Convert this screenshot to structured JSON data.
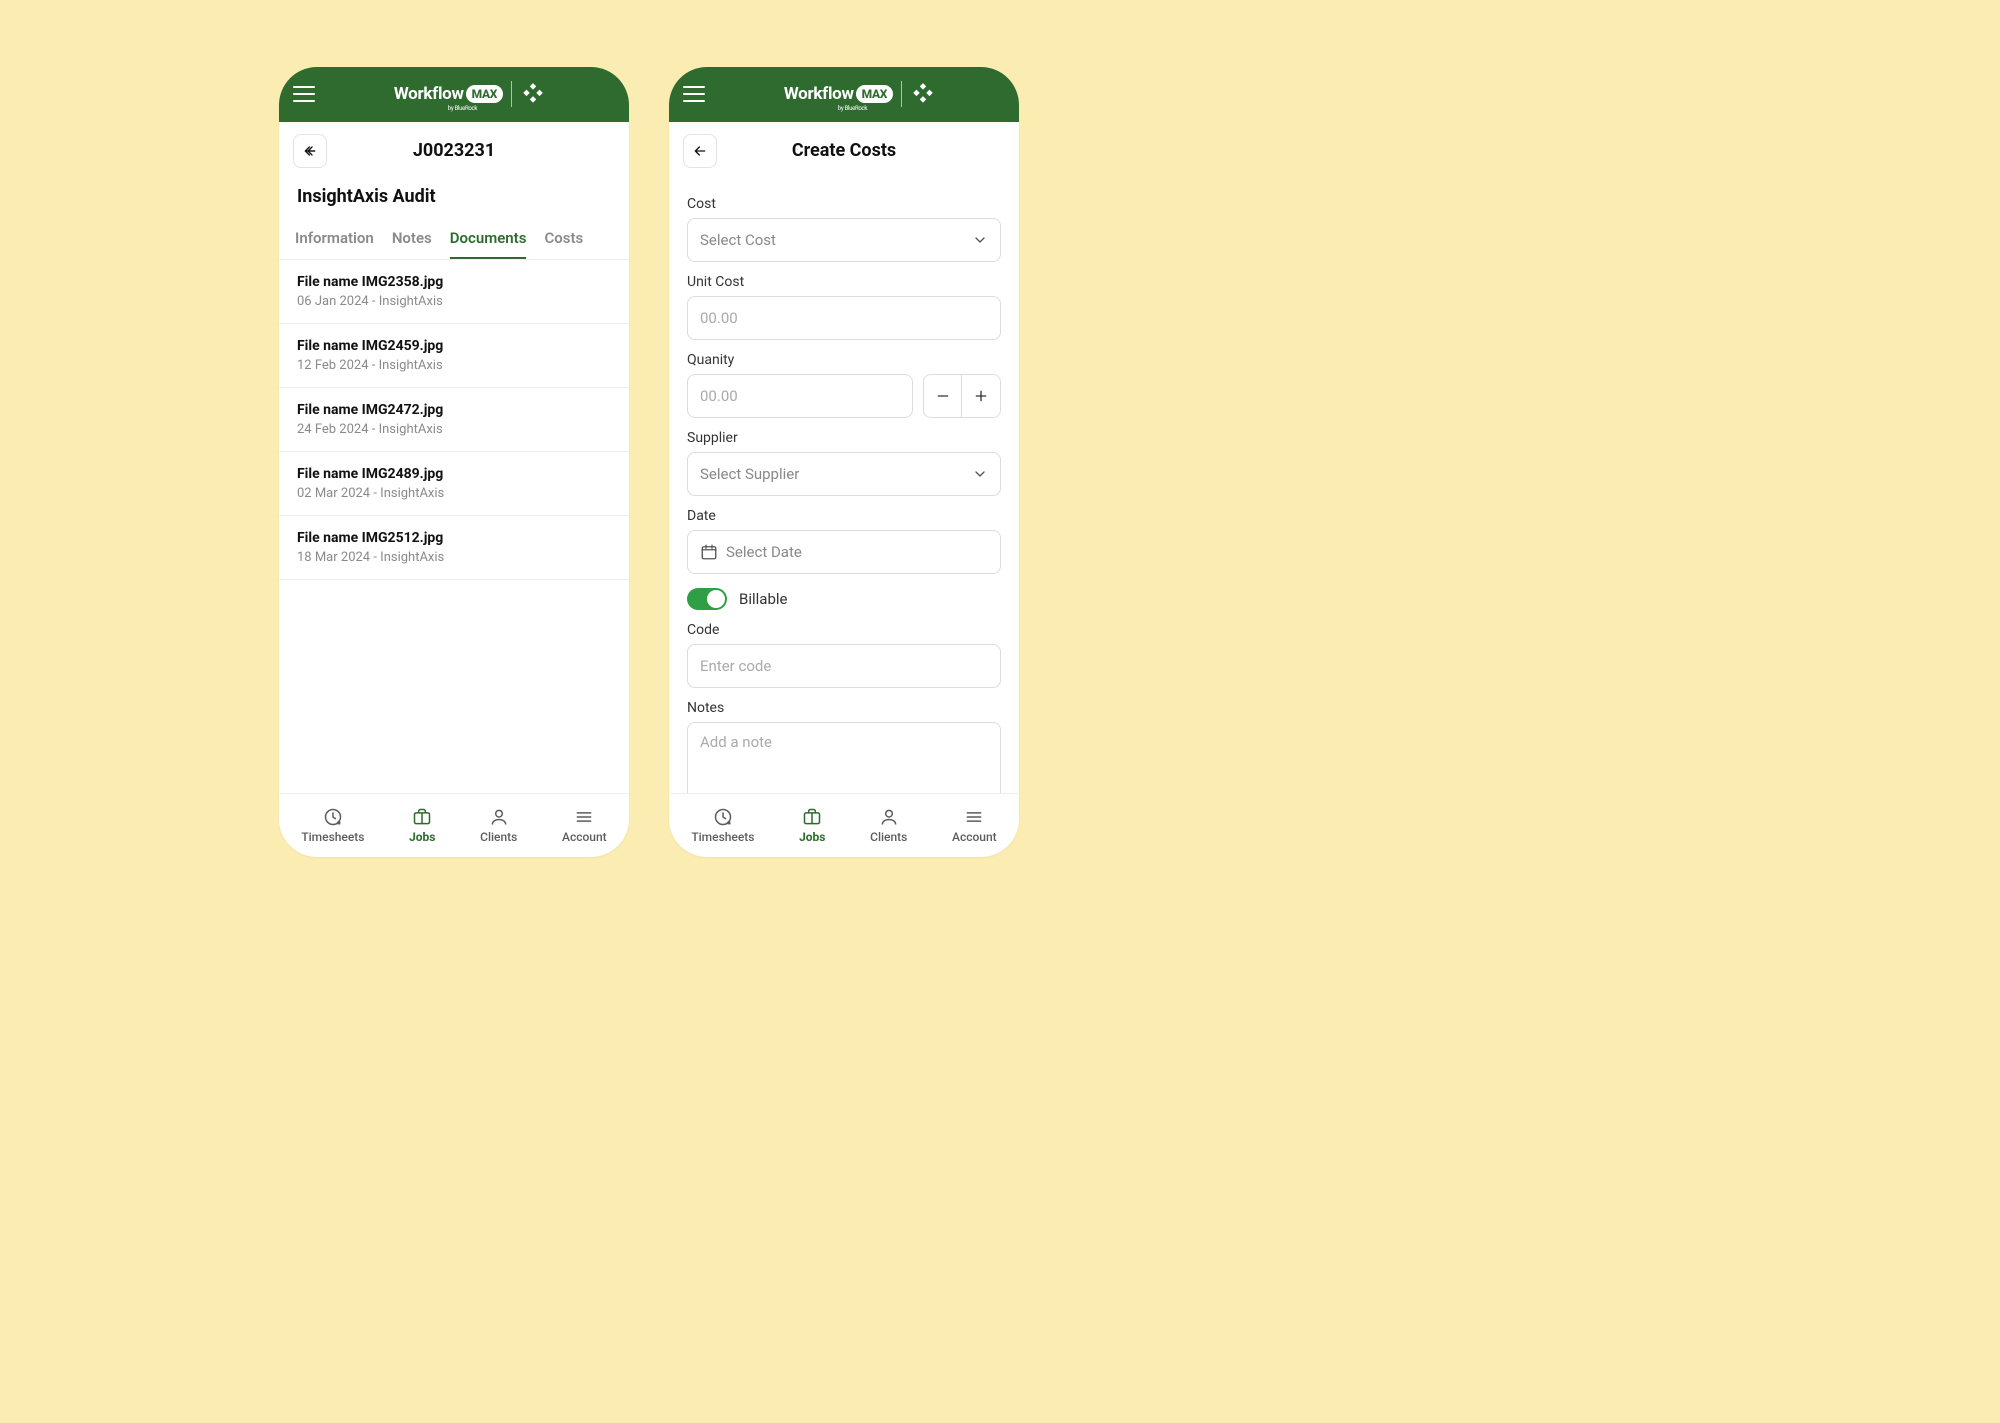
{
  "brand": {
    "word": "Workflow",
    "badge": "MAX",
    "sub": "by BlueRock"
  },
  "left": {
    "header_title": "J0023231",
    "job_title": "InsightAxis Audit",
    "tabs": [
      {
        "label": "Information"
      },
      {
        "label": "Notes"
      },
      {
        "label": "Documents"
      },
      {
        "label": "Costs"
      }
    ],
    "documents": [
      {
        "name": "File name IMG2358.jpg",
        "meta": "06 Jan 2024 - InsightAxis"
      },
      {
        "name": "File name IMG2459.jpg",
        "meta": "12 Feb 2024 - InsightAxis"
      },
      {
        "name": "File name IMG2472.jpg",
        "meta": "24 Feb 2024 - InsightAxis"
      },
      {
        "name": "File name IMG2489.jpg",
        "meta": "02 Mar 2024 - InsightAxis"
      },
      {
        "name": "File name IMG2512.jpg",
        "meta": "18 Mar 2024 - InsightAxis"
      }
    ]
  },
  "right": {
    "header_title": "Create Costs",
    "fields": {
      "cost_label": "Cost",
      "cost_placeholder": "Select Cost",
      "unit_cost_label": "Unit Cost",
      "unit_cost_placeholder": "00.00",
      "quantity_label": "Quanity",
      "quantity_placeholder": "00.00",
      "supplier_label": "Supplier",
      "supplier_placeholder": "Select Supplier",
      "date_label": "Date",
      "date_placeholder": "Select Date",
      "billable_label": "Billable",
      "code_label": "Code",
      "code_placeholder": "Enter code",
      "notes_label": "Notes",
      "notes_placeholder": "Add a note"
    }
  },
  "nav": {
    "timesheets": "Timesheets",
    "jobs": "Jobs",
    "clients": "Clients",
    "account": "Account"
  }
}
